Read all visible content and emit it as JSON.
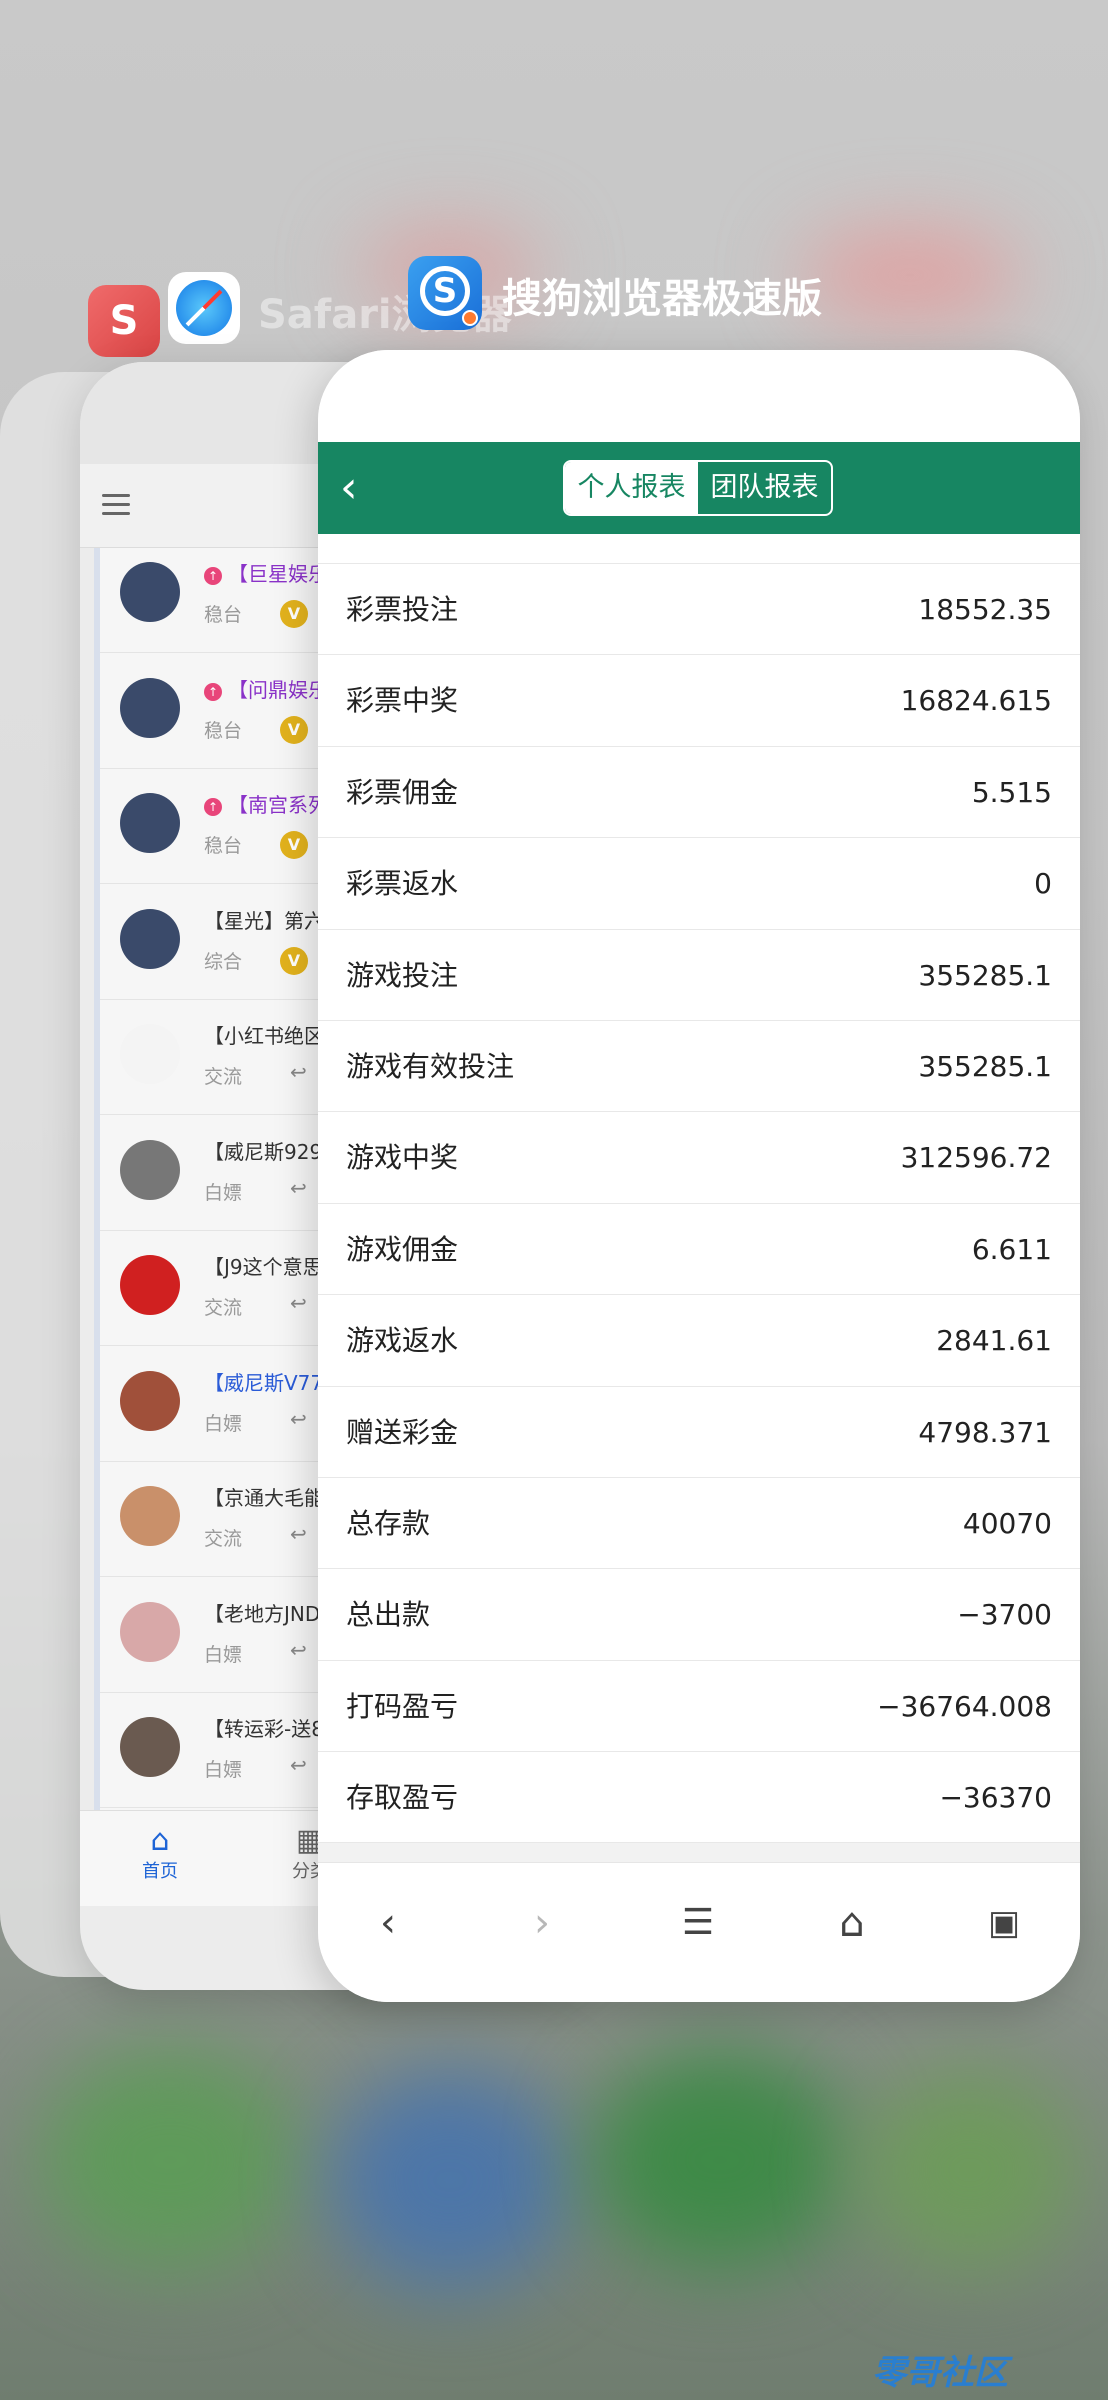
{
  "switcher": {
    "safari_label": "Safari浏览器",
    "sogou_label": "搜狗浏览器极速版",
    "soul_icon_text": "S"
  },
  "safari_card": {
    "items": [
      {
        "title": "【巨星娱乐",
        "tag": "稳台",
        "hot": true,
        "style": "purple",
        "badge": "V"
      },
      {
        "title": "【问鼎娱乐",
        "tag": "稳台",
        "hot": true,
        "style": "purple",
        "badge": "V"
      },
      {
        "title": "【南宫系列",
        "tag": "稳台",
        "hot": true,
        "style": "purple",
        "badge": "V"
      },
      {
        "title": "【星光】第六",
        "tag": "综合",
        "hot": false,
        "style": "normal",
        "badge": "V"
      },
      {
        "title": "【小红书绝区",
        "tag": "交流",
        "hot": false,
        "style": "normal",
        "badge": ""
      },
      {
        "title": "【威尼斯929",
        "tag": "白嫖",
        "hot": false,
        "style": "normal",
        "badge": ""
      },
      {
        "title": "【J9这个意思",
        "tag": "交流",
        "hot": false,
        "style": "normal",
        "badge": ""
      },
      {
        "title": "【威尼斯V77",
        "tag": "白嫖",
        "hot": false,
        "style": "blue",
        "badge": ""
      },
      {
        "title": "【京通大毛能",
        "tag": "交流",
        "hot": false,
        "style": "normal",
        "badge": ""
      },
      {
        "title": "【老地方JND",
        "tag": "白嫖",
        "hot": false,
        "style": "normal",
        "badge": ""
      },
      {
        "title": "【转运彩-送8",
        "tag": "白嫖",
        "hot": false,
        "style": "normal",
        "badge": ""
      }
    ],
    "tabs": {
      "home": "首页",
      "category": "分类"
    }
  },
  "report": {
    "tab_personal": "个人报表",
    "tab_team": "团队报表",
    "rows": [
      {
        "label": "彩票投注",
        "value": "18552.35"
      },
      {
        "label": "彩票中奖",
        "value": "16824.615"
      },
      {
        "label": "彩票佣金",
        "value": "5.515"
      },
      {
        "label": "彩票返水",
        "value": "0"
      },
      {
        "label": "游戏投注",
        "value": "355285.1"
      },
      {
        "label": "游戏有效投注",
        "value": "355285.1"
      },
      {
        "label": "游戏中奖",
        "value": "312596.72"
      },
      {
        "label": "游戏佣金",
        "value": "6.611"
      },
      {
        "label": "游戏返水",
        "value": "2841.61"
      },
      {
        "label": "赠送彩金",
        "value": "4798.371"
      },
      {
        "label": "总存款",
        "value": "40070"
      },
      {
        "label": "总出款",
        "value": "−3700"
      },
      {
        "label": "打码盈亏",
        "value": "−36764.008"
      },
      {
        "label": "存取盈亏",
        "value": "−36370"
      }
    ]
  },
  "colors": {
    "header_green": "#178662",
    "accent_blue": "#1e64d6"
  },
  "watermark": "零哥社区"
}
